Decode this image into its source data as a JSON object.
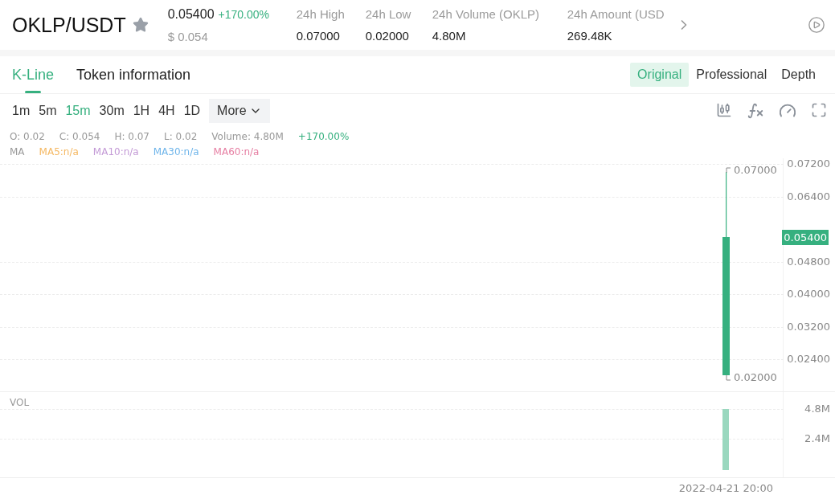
{
  "header": {
    "pair": "OKLP/USDT",
    "favorite": false,
    "price": "0.05400",
    "change": "+170.00%",
    "fiat_price": "$ 0.054",
    "stats": [
      {
        "label": "24h High",
        "value": "0.07000"
      },
      {
        "label": "24h Low",
        "value": "0.02000"
      },
      {
        "label": "24h Volume (OKLP)",
        "value": "4.80M"
      },
      {
        "label": "24h Amount (USD",
        "value": "269.48K"
      }
    ]
  },
  "tabs": [
    {
      "label": "K-Line",
      "selected": true
    },
    {
      "label": "Token information",
      "selected": false
    }
  ],
  "view_modes": [
    {
      "label": "Original",
      "selected": true
    },
    {
      "label": "Professional",
      "selected": false
    },
    {
      "label": "Depth",
      "selected": false
    }
  ],
  "intervals": [
    {
      "label": "1m",
      "selected": false
    },
    {
      "label": "5m",
      "selected": false
    },
    {
      "label": "15m",
      "selected": true
    },
    {
      "label": "30m",
      "selected": false
    },
    {
      "label": "1H",
      "selected": false
    },
    {
      "label": "4H",
      "selected": false
    },
    {
      "label": "1D",
      "selected": false
    }
  ],
  "more_button": "More",
  "ohlc": [
    "O: 0.02",
    "C: 0.054",
    "H: 0.07",
    "L: 0.02",
    "Volume: 4.80M"
  ],
  "ohlc_change": "+170.00%",
  "ma_label": "MA",
  "ma_lines": [
    {
      "label": "MA5:n/a",
      "color": "#f5b862"
    },
    {
      "label": "MA10:n/a",
      "color": "#c39ad6"
    },
    {
      "label": "MA30:n/a",
      "color": "#6fb5ea"
    },
    {
      "label": "MA60:n/a",
      "color": "#e67ea2"
    }
  ],
  "price_axis": [
    "0.07200",
    "0.06400",
    "0.04800",
    "0.04000",
    "0.03200",
    "0.02400"
  ],
  "high_marker": "0.07000",
  "low_marker": "0.02000",
  "last_price": "0.05400",
  "volume_label": "VOL",
  "volume_axis": [
    "4.8M",
    "2.4M"
  ],
  "time_label": "2022-04-21 20:00"
}
